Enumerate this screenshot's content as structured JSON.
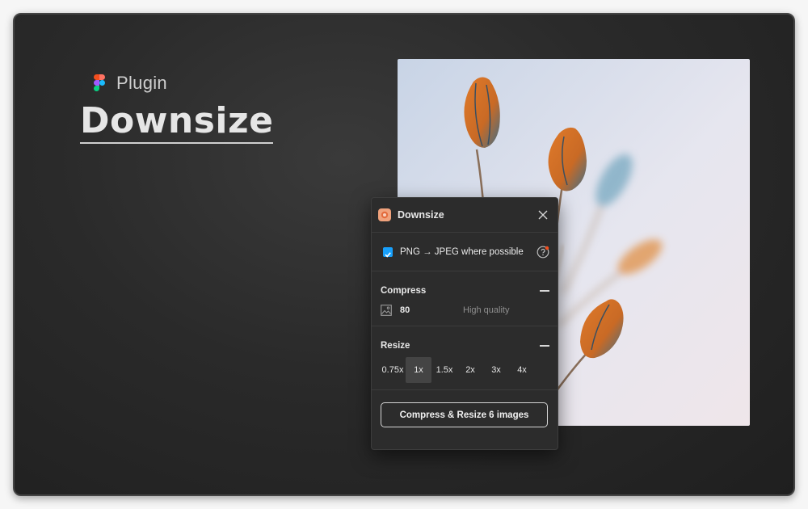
{
  "brand": {
    "label": "Plugin"
  },
  "headline": "Downsize",
  "plugin": {
    "title": "Downsize",
    "option_label": "PNG → JPEG where possible",
    "option_checked": true,
    "compress": {
      "title": "Compress",
      "quality_value": "80",
      "quality_label": "High quality"
    },
    "resize": {
      "title": "Resize",
      "scales": [
        "0.75x",
        "1x",
        "1.5x",
        "2x",
        "3x",
        "4x"
      ],
      "selected": "1x"
    },
    "action_label": "Compress & Resize 6 images"
  },
  "icons": {
    "brand": "figma-logo-icon",
    "plugin": "plugin-app-icon",
    "close": "close-icon",
    "check": "checkmark-icon",
    "help": "help-icon",
    "collapse": "minus-icon",
    "image": "image-icon"
  },
  "colors": {
    "accent": "#18a0fb",
    "panel_bg": "#2c2c2c",
    "card_bg": "#2a2a2a",
    "badge": "#f24e1e"
  }
}
